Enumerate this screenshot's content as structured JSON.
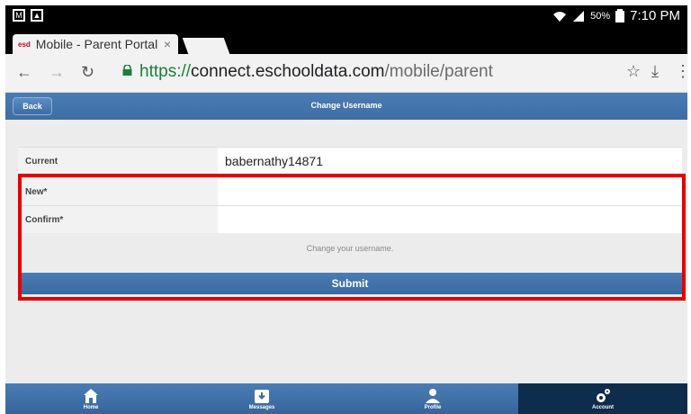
{
  "statusbar": {
    "battery": "50%",
    "time": "7:10 PM"
  },
  "tab": {
    "favicon_text": "esd",
    "title": "Mobile - Parent Portal",
    "close": "×"
  },
  "url": {
    "scheme": "https://",
    "host": "connect.eschooldata.com",
    "path": "/mobile/parent"
  },
  "header": {
    "back": "Back",
    "title": "Change Username"
  },
  "form": {
    "current_label": "Current",
    "current_value": "babernathy14871",
    "new_label": "New*",
    "new_value": "",
    "confirm_label": "Confirm*",
    "confirm_value": "",
    "hint": "Change your username.",
    "submit": "Submit"
  },
  "footer": {
    "items": [
      {
        "label": "Home",
        "icon": "home-icon"
      },
      {
        "label": "Messages",
        "icon": "inbox-icon"
      },
      {
        "label": "Profile",
        "icon": "user-icon"
      },
      {
        "label": "Account",
        "icon": "gear-icon"
      }
    ],
    "active": "Account"
  },
  "colors": {
    "accent": "#3e6da4",
    "highlight": "#e60000",
    "url_scheme": "#188038"
  }
}
